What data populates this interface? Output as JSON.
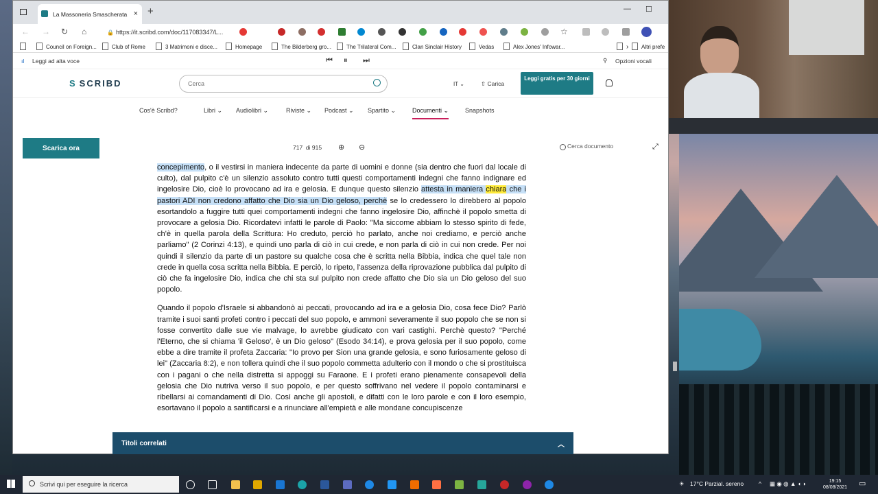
{
  "browser": {
    "tab_title": "La Massoneria Smascherata",
    "url": "https://it.scribd.com/doc/117083347/L...",
    "bookmarks": [
      "Council on Foreign...",
      "Club of Rome",
      "3 Matrimoni e disce...",
      "Homepage",
      "The Bilderberg gro...",
      "The Trilateral Com...",
      "Clan Sinclair History",
      "Vedas",
      "Alex Jones' Infowar...",
      "Altri prefe"
    ],
    "read_aloud": "Leggi ad alta voce",
    "voice_options": "Opzioni vocali"
  },
  "scribd": {
    "logo": "SCRIBD",
    "search_placeholder": "Cerca",
    "lang": "IT",
    "upload": "Carica",
    "cta": "Leggi gratis per 30 giorni",
    "menu": [
      "Cos'è Scribd?",
      "Libri",
      "Audiolibri",
      "Riviste",
      "Podcast",
      "Spartito",
      "Documenti",
      "Snapshots"
    ],
    "download": "Scarica ora",
    "page_current": "717",
    "page_total": "di 915",
    "doc_search_placeholder": "Cerca documento",
    "related": "Titoli correlati"
  },
  "doc": {
    "p1_a": "concepimento",
    "p1_b": ", o il vestirsi in maniera indecente da parte di uomini e donne (sia dentro che fuori dal locale di culto), dal pulpito c'è un silenzio assoluto contro tutti questi comportamenti indegni che fanno indignare ed ingelosire Dio, cioè lo provocano ad ira e gelosia. E dunque questo silenzio ",
    "p1_hl1": "attesta in maniera ",
    "p1_hly": "chiara",
    "p1_hl2": " che i pastori ADI non credono affatto che Dio sia un Dio geloso, perchè",
    "p1_c": " se lo credessero lo direbbero al popolo esortandolo a fuggire tutti quei comportamenti indegni che fanno ingelosire Dio, affinchè il popolo smetta di provocare a gelosia Dio. Ricordatevi infatti le parole di Paolo: \"Ma siccome abbiam lo stesso spirito di fede, ch'è in quella parola della Scrittura: Ho creduto, perciò ho parlato, anche noi crediamo, e perciò anche parliamo\" (2 Corinzi 4:13), e quindi uno parla di ciò in cui crede, e non parla di ciò in cui non crede. Per noi quindi il silenzio da parte di un pastore su qualche cosa che è scritta nella Bibbia, indica che quel tale non crede in quella cosa scritta nella Bibbia. E perciò, lo ripeto, l'assenza della riprovazione pubblica dal pulpito di ciò che fa ingelosire Dio, indica che chi sta sul pulpito non crede affatto che Dio sia un Dio geloso del suo popolo.",
    "p2": "Quando il popolo d'Israele si abbandonò ai peccati, provocando ad ira e a gelosia Dio, cosa fece Dio? Parlò tramite i suoi santi profeti contro i peccati del suo popolo, e ammonì severamente il suo popolo che se non si fosse convertito dalle sue vie malvage, lo avrebbe giudicato con vari castighi. Perchè questo? \"Perché l'Eterno, che si chiama 'il Geloso', è un Dio geloso\" (Esodo 34:14), e prova gelosia per il suo popolo, come ebbe a dire tramite il profeta Zaccaria: \"Io provo per Sion una grande gelosia, e sono furiosamente geloso di lei\" (Zaccaria 8:2), e non tollera quindi che il suo popolo commetta adulterio con il mondo o che si prostituisca con i pagani o che nella distretta si appoggi su Faraone. E i profeti erano pienamente consapevoli della gelosia che Dio nutriva verso il suo popolo, e per questo soffrivano nel vedere il popolo contaminarsi e ribellarsi ai comandamenti di Dio. Così anche gli apostoli, e difatti con le loro parole e con il loro esempio, esortavano il popolo a santificarsi e a rinunciare all'empietà e alle mondane concupiscenze"
  },
  "taskbar": {
    "search": "Scrivi qui per eseguire la ricerca",
    "weather": "17°C  Parzial. sereno",
    "time": "19:15",
    "date": "08/08/2021"
  }
}
